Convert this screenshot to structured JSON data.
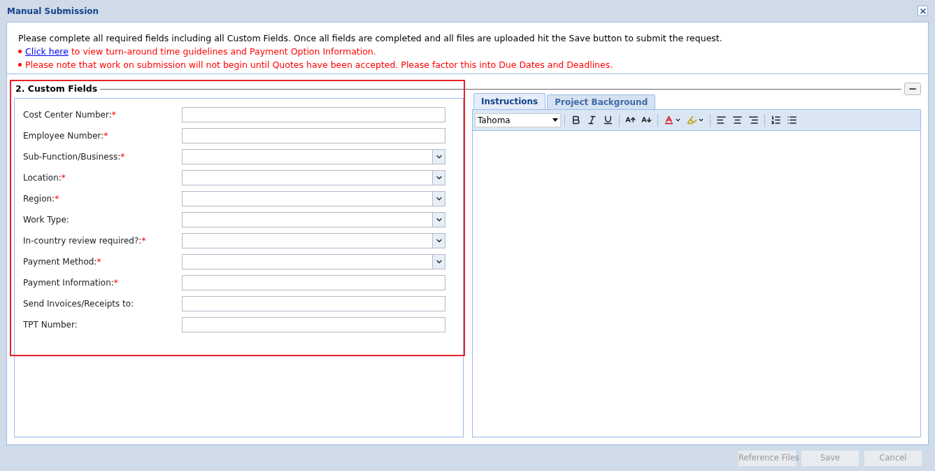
{
  "window": {
    "title": "Manual Submission"
  },
  "intro": "Please complete all required fields including all Custom Fields. Once all fields are completed and all files are uploaded hit the Save button to submit the request.",
  "notes": [
    {
      "link": "Click here",
      "text": "to view turn-around time guidelines and Payment Option Information."
    },
    {
      "text": "Please note that work on submission will not begin until Quotes have been accepted. Please factor this into Due Dates and Deadlines."
    }
  ],
  "section": {
    "title": "2. Custom Fields",
    "highlighted": true
  },
  "fields": [
    {
      "label": "Cost Center Number:",
      "required_mark": "*",
      "kind": "text"
    },
    {
      "label": "Employee Number:",
      "required_mark": "*",
      "kind": "text"
    },
    {
      "label": "Sub-Function/Business:",
      "required_mark": "*",
      "kind": "select"
    },
    {
      "label": "Location:",
      "required_mark": "*",
      "kind": "select"
    },
    {
      "label": "Region:",
      "required_mark": "*",
      "kind": "select"
    },
    {
      "label": "Work Type:",
      "kind": "select"
    },
    {
      "label": "In-country review required?:",
      "required_mark": "*",
      "kind": "select"
    },
    {
      "label": "Payment Method:",
      "required_mark": "*",
      "kind": "select"
    },
    {
      "label": "Payment Information:",
      "required_mark": "*",
      "kind": "text"
    },
    {
      "label": "Send Invoices/Receipts to:",
      "kind": "text"
    },
    {
      "label": "TPT Number:",
      "kind": "text"
    }
  ],
  "tabs": [
    {
      "label": "Instructions",
      "selected": true
    },
    {
      "label": "Project Background",
      "selected": false
    }
  ],
  "editor": {
    "font": "Tahoma"
  },
  "buttons": [
    {
      "label": "Reference Files",
      "disabled": true
    },
    {
      "label": "Save",
      "disabled": true
    },
    {
      "label": "Cancel",
      "disabled": true
    }
  ]
}
